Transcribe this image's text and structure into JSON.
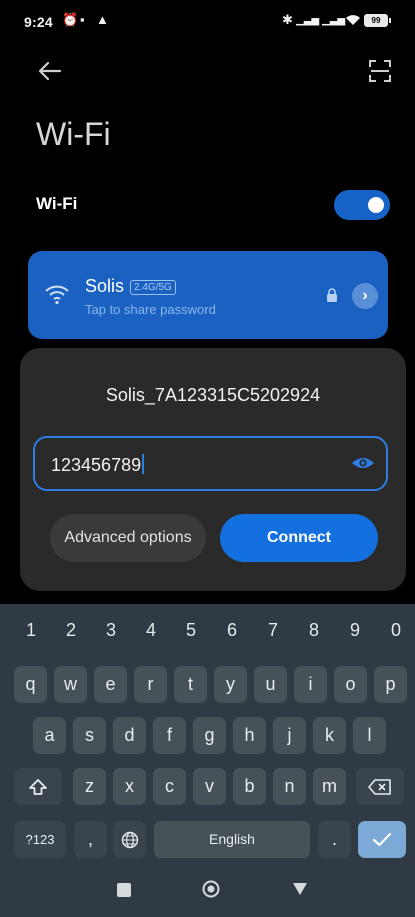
{
  "status_bar": {
    "time": "9:24",
    "battery": "99"
  },
  "page": {
    "title": "Wi-Fi",
    "wifi_toggle_label": "Wi-Fi",
    "wifi_enabled": true
  },
  "network": {
    "name": "Solis",
    "band_badge": "2.4G/5G",
    "subtitle": "Tap to share password"
  },
  "dialog": {
    "title": "Solis_7A123315C5202924",
    "password_value": "123456789",
    "advanced_label": "Advanced options",
    "connect_label": "Connect"
  },
  "keyboard": {
    "numbers": [
      "1",
      "2",
      "3",
      "4",
      "5",
      "6",
      "7",
      "8",
      "9",
      "0"
    ],
    "row1": [
      "q",
      "w",
      "e",
      "r",
      "t",
      "y",
      "u",
      "i",
      "o",
      "p"
    ],
    "row2": [
      "a",
      "s",
      "d",
      "f",
      "g",
      "h",
      "j",
      "k",
      "l"
    ],
    "row3": [
      "z",
      "x",
      "c",
      "v",
      "b",
      "n",
      "m"
    ],
    "symbols_label": "?123",
    "comma": ",",
    "space_label": "English",
    "period": "."
  },
  "colors": {
    "accent": "#1470de",
    "card": "#1a61c2",
    "dialog": "#2a2a2a",
    "keyboard": "#2f3a44"
  },
  "icons": {
    "back": "arrow-left-icon",
    "scan": "scan-qr-icon",
    "wifi": "wifi-icon",
    "lock": "lock-icon",
    "eye": "eye-icon",
    "globe": "globe-icon",
    "shift": "shift-icon",
    "backspace": "backspace-icon",
    "enter": "checkmark-icon"
  }
}
